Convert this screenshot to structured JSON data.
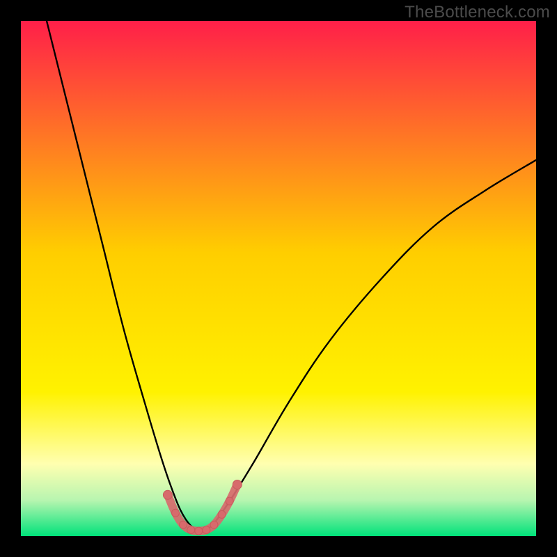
{
  "watermark": "TheBottleneck.com",
  "colors": {
    "frame": "#000000",
    "grad_top": "#ff1f49",
    "grad_mid": "#ffce00",
    "grad_yellow": "#fff200",
    "grad_pale": "#ffffb0",
    "grad_green1": "#b8f5b0",
    "grad_green2": "#00e27a",
    "curve": "#000000",
    "marker_fill": "#d76a6c",
    "marker_stroke": "#c85a5c"
  },
  "chart_data": {
    "type": "line",
    "title": "",
    "xlabel": "",
    "ylabel": "",
    "xlim": [
      0,
      100
    ],
    "ylim": [
      0,
      100
    ],
    "series": [
      {
        "name": "bottleneck-curve",
        "x": [
          5,
          8,
          12,
          16,
          20,
          24,
          27,
          29,
          31,
          33,
          35,
          37,
          40,
          45,
          52,
          60,
          70,
          80,
          90,
          100
        ],
        "y": [
          100,
          88,
          72,
          56,
          40,
          26,
          16,
          10,
          5,
          2,
          1,
          2,
          6,
          14,
          26,
          38,
          50,
          60,
          67,
          73
        ]
      }
    ],
    "markers": {
      "name": "highlight-points",
      "x": [
        28.5,
        30,
        31.5,
        33,
        34.5,
        36,
        37.5,
        39,
        40.5,
        42
      ],
      "y": [
        8,
        4.5,
        2.2,
        1.2,
        1.0,
        1.2,
        2.2,
        4.2,
        6.8,
        10
      ],
      "r_small": 5.5,
      "r_end": 6.5
    },
    "gradient_stops": [
      {
        "offset": 0.0,
        "color_key": "grad_top"
      },
      {
        "offset": 0.45,
        "color_key": "grad_mid"
      },
      {
        "offset": 0.72,
        "color_key": "grad_yellow"
      },
      {
        "offset": 0.86,
        "color_key": "grad_pale"
      },
      {
        "offset": 0.93,
        "color_key": "grad_green1"
      },
      {
        "offset": 1.0,
        "color_key": "grad_green2"
      }
    ]
  }
}
